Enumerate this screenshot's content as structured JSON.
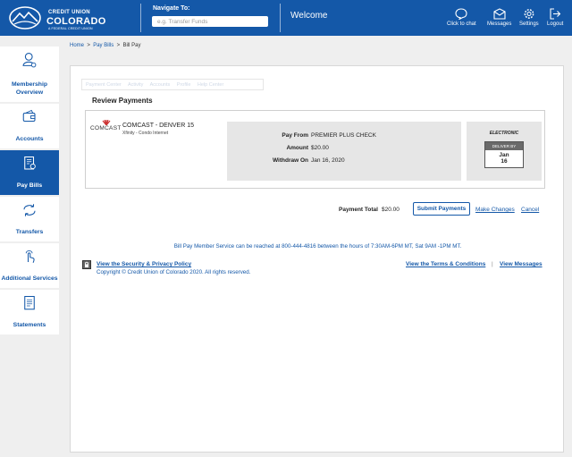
{
  "header": {
    "logo": {
      "line1": "CREDIT UNION",
      "line2": "COLORADO",
      "tagline": "A FEDERAL CREDIT UNION"
    },
    "nav_label": "Navigate To:",
    "nav_placeholder": "e.g. Transfer Funds",
    "welcome": "Welcome",
    "actions": [
      {
        "label": "Click to chat",
        "icon": "chat-icon"
      },
      {
        "label": "Messages",
        "icon": "envelope-icon"
      },
      {
        "label": "Settings",
        "icon": "gear-icon"
      },
      {
        "label": "Logout",
        "icon": "logout-icon"
      }
    ]
  },
  "sidebar": {
    "items": [
      {
        "label": "Membership Overview",
        "icon": "user-icon"
      },
      {
        "label": "Accounts",
        "icon": "wallet-icon"
      },
      {
        "label": "Pay Bills",
        "icon": "bill-icon",
        "active": true
      },
      {
        "label": "Transfers",
        "icon": "transfer-icon"
      },
      {
        "label": "Additional Services",
        "icon": "touch-icon"
      },
      {
        "label": "Statements",
        "icon": "statement-icon"
      }
    ]
  },
  "breadcrumb": {
    "home": "Home",
    "paybills": "Pay Bills",
    "current": "Bill Pay",
    "sep": ">"
  },
  "tabs": [
    "Payment Center",
    "Activity",
    "Accounts",
    "Profile",
    "Help Center"
  ],
  "review": {
    "title": "Review Payments",
    "payee": {
      "logo_text": "COMCAST",
      "name": "COMCAST - DENVER 15",
      "nickname": "Xfinity - Condo Internet"
    },
    "pay_from_label": "Pay From",
    "pay_from": "PREMIER PLUS CHECK",
    "amount_label": "Amount",
    "amount": "$20.00",
    "withdraw_label": "Withdraw On",
    "withdraw": "Jan 16, 2020",
    "method": "ELECTRONIC",
    "deliver_by_label": "DELIVER BY",
    "deliver_month": "Jan",
    "deliver_day": "16"
  },
  "totals": {
    "label": "Payment Total",
    "value": "$20.00",
    "submit": "Submit Payments",
    "make_changes": "Make Changes",
    "cancel": "Cancel"
  },
  "footer": {
    "member_service": "Bill Pay Member Service can be reached at 800-444-4816 between the hours of 7:30AM-6PM MT, Sat 9AM -1PM MT.",
    "security_link": "View the Security & Privacy Policy",
    "copyright": "Copyright © Credit Union of Colorado 2020. All rights reserved.",
    "terms_link": "View the Terms & Conditions",
    "separator": "|",
    "messages_link": "View Messages"
  },
  "colors": {
    "brand": "#1458a8",
    "background": "#efefef"
  }
}
